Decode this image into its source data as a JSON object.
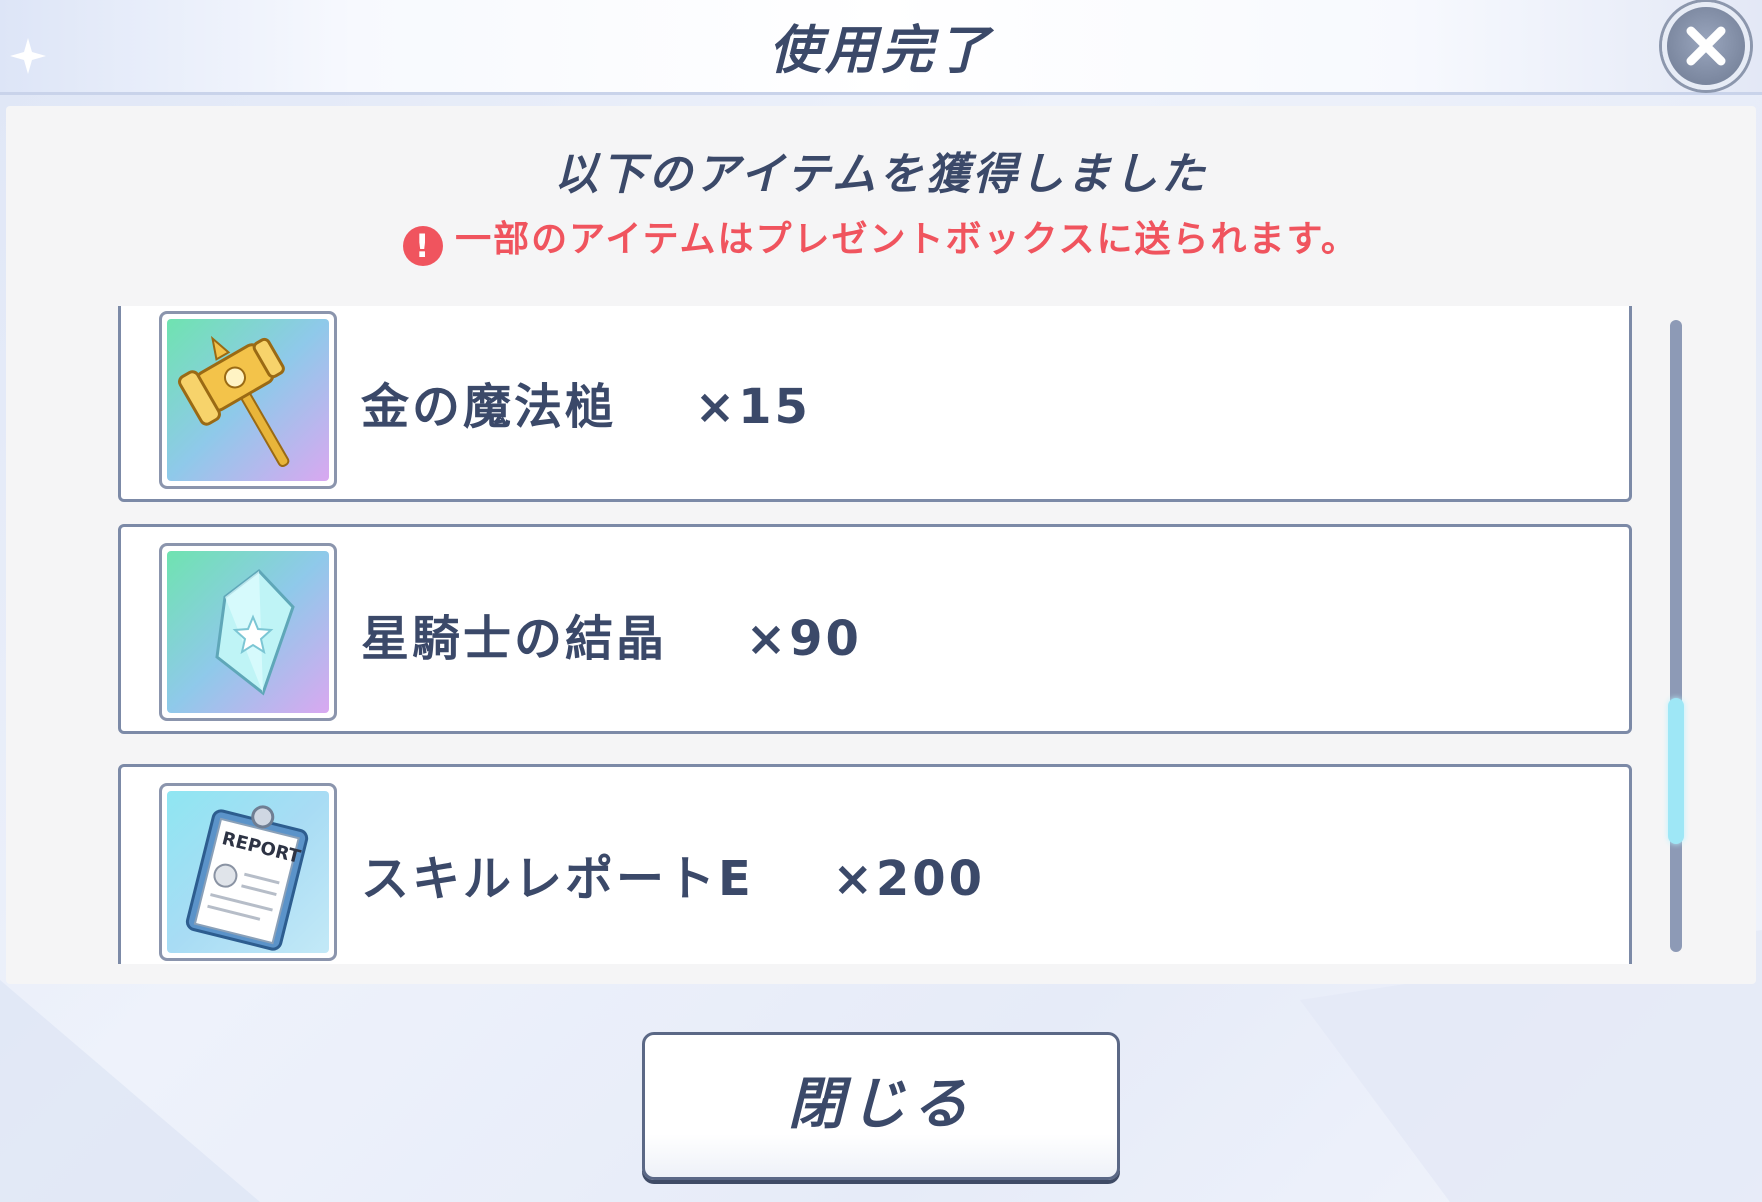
{
  "dialog": {
    "title": "使用完了",
    "heading": "以下のアイテムを獲得しました",
    "notice": "一部のアイテムはプレゼントボックスに送られます。",
    "close_button_label": "閉じる"
  },
  "items": [
    {
      "name": "金の魔法槌",
      "quantity": "×15",
      "icon": "gold-hammer-icon"
    },
    {
      "name": "星騎士の結晶",
      "quantity": "×90",
      "icon": "star-knight-crystal-icon"
    },
    {
      "name": "スキルレポートE",
      "quantity": "×200",
      "icon": "skill-report-icon",
      "icon_text": "REPORT"
    }
  ],
  "scrollbar": {
    "position": 0.75
  },
  "colors": {
    "text_main": "#3b4969",
    "notice_red": "#f0545e",
    "scroll_thumb": "#9ee7f6"
  }
}
